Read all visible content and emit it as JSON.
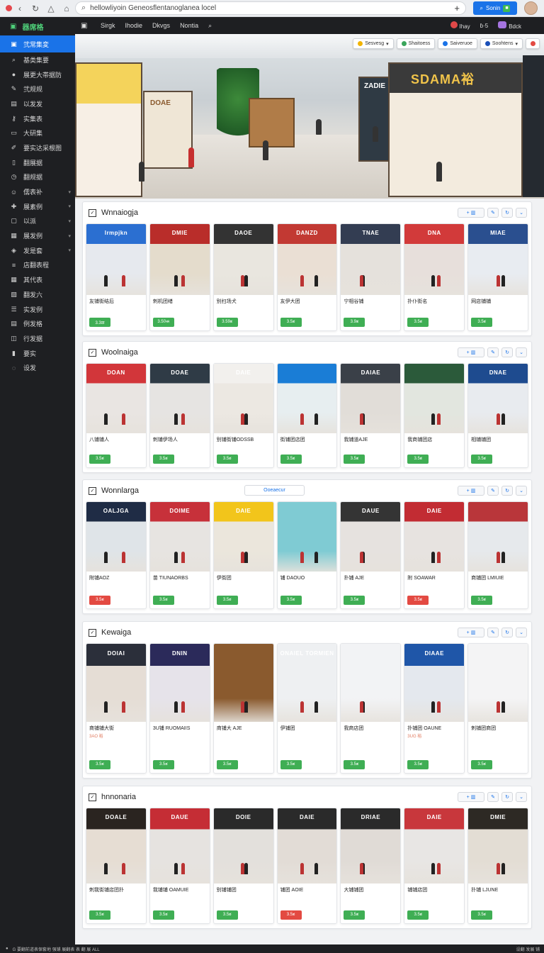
{
  "browser": {
    "address": "hellowliyoin Geneosflentanoglanea locel",
    "cta_label": "Sonin"
  },
  "sidebar": {
    "header": "器席格",
    "items": [
      {
        "label": "弐常集変",
        "icon": "window-icon",
        "active": true
      },
      {
        "label": "基类集要",
        "icon": "search-icon"
      },
      {
        "label": "展更大帯据防",
        "icon": "drop-icon"
      },
      {
        "label": "弐规规",
        "icon": "wrench-icon"
      },
      {
        "label": "以发发",
        "icon": "chart-icon"
      },
      {
        "label": "实集表",
        "icon": "key-icon"
      },
      {
        "label": "大研集",
        "icon": "folder-icon"
      },
      {
        "label": "要实达采根图",
        "icon": "pen-icon"
      },
      {
        "label": "翻展据",
        "icon": "doc-icon"
      },
      {
        "label": "翻规据",
        "icon": "clock-icon"
      },
      {
        "label": "儒表补",
        "icon": "users-icon",
        "chevron": true
      },
      {
        "label": "展素例",
        "icon": "puzzle-icon",
        "chevron": true
      },
      {
        "label": "以派",
        "icon": "box-icon",
        "chevron": true
      },
      {
        "label": "展发例",
        "icon": "cart-icon",
        "chevron": true
      },
      {
        "label": "发是套",
        "icon": "tag-icon",
        "chevron": true
      },
      {
        "label": "店翻表程",
        "icon": "stack-icon"
      },
      {
        "label": "其代表",
        "icon": "grid-icon"
      },
      {
        "label": "翻发六",
        "icon": "image-icon"
      },
      {
        "label": "实发例",
        "icon": "list-icon"
      },
      {
        "label": "例发格",
        "icon": "file-icon"
      },
      {
        "label": "行发据",
        "icon": "layers-icon"
      },
      {
        "label": "要实",
        "icon": "bookmark-icon"
      },
      {
        "label": "设发",
        "icon": "chat-icon"
      }
    ]
  },
  "topbar": {
    "links": [
      "Sirgk",
      "Ihodie",
      "Dkvgs",
      "Nontia"
    ],
    "right": [
      "Ihay",
      "ɓ·5",
      "Bdck"
    ]
  },
  "hero": {
    "sign_right": "SDAMA裕",
    "sign_mid": "ZADIE",
    "sign_left": "DOAE",
    "chips": [
      "Sesvesg",
      "Shaitoess",
      "Saiveruoe",
      "Soohtens"
    ]
  },
  "sections": [
    {
      "title": "Wnnaiogja",
      "cards": [
        {
          "title": "友铺街结后",
          "price": "3.3ळ",
          "color": "green",
          "bg": "#e6e9ee",
          "band": "#2b6fd1",
          "sign": "lrmpjkn"
        },
        {
          "title": "刺机团绪",
          "price": "3.50ಈ",
          "color": "green",
          "bg": "#e4dccc",
          "band": "#b92d2a",
          "sign": "DMIE"
        },
        {
          "title": "别扫场犬",
          "price": "3.59ಶ",
          "color": "green",
          "bg": "#e9e6df",
          "band": "#333",
          "sign": "DAOE"
        },
        {
          "title": "友伊大团",
          "price": "3.5ಶ",
          "color": "green",
          "bg": "#eadfd4",
          "band": "#c23933",
          "sign": "DANZD"
        },
        {
          "title": "宁相谷铺",
          "price": "3.9ಶ",
          "color": "green",
          "bg": "#e5e1dc",
          "band": "#333d52",
          "sign": "TNAE"
        },
        {
          "title": "扑仆街名",
          "price": "3.5ಶ",
          "color": "green",
          "bg": "#e7dfdb",
          "band": "#d23a3a",
          "sign": "DNA"
        },
        {
          "title": "网店铺铺",
          "price": "3.5ಶ",
          "color": "green",
          "bg": "#e8ecf1",
          "band": "#2a4f8f",
          "sign": "MIAE"
        }
      ]
    },
    {
      "title": "Woolnaiga",
      "cards": [
        {
          "title": "八铺铺人",
          "price": "3.5ಶ",
          "color": "green",
          "bg": "#e9e5e2",
          "band": "#d2363a",
          "sign": "DOAN"
        },
        {
          "title": "刺铺伊场人",
          "price": "3.5ಶ",
          "color": "green",
          "bg": "#e6e4e2",
          "band": "#2f3b46",
          "sign": "DOAE"
        },
        {
          "title": "别铺街铺ODSSB",
          "price": "3.5ಶ",
          "color": "green",
          "bg": "#ece8e2",
          "band": "#f2f0ed",
          "sign": "DAIE"
        },
        {
          "title": "街铺团店团",
          "price": "3.5ಶ",
          "color": "green",
          "bg": "#e7eef0",
          "band": "#1a7dd6",
          "sign": ""
        },
        {
          "title": "我铺道AJE",
          "price": "3.5ಶ",
          "color": "green",
          "bg": "#e1ddd8",
          "band": "#3a4048",
          "sign": "DAIAE"
        },
        {
          "title": "我商铺团店",
          "price": "3.5ಶ",
          "color": "green",
          "bg": "#e2e6df",
          "band": "#2b5a3a",
          "sign": ""
        },
        {
          "title": "相铺铺团",
          "price": "3.5ಶ",
          "color": "green",
          "bg": "#e8ebef",
          "band": "#1e4b8f",
          "sign": "DNAE"
        }
      ]
    },
    {
      "title": "Wonnlarga",
      "mid_button": "Ooeaecur",
      "cards": [
        {
          "title": "附铺AOZ",
          "price": "3.5ಶ",
          "color": "red",
          "bg": "#dfe4e8",
          "band": "#1f2c45",
          "sign": "OALJGA"
        },
        {
          "title": "苗 TIUNAORBS",
          "price": "3.5ಶ",
          "color": "green",
          "bg": "#e7e4e1",
          "band": "#c7313a",
          "sign": "DOIME"
        },
        {
          "title": "伊街团",
          "price": "3.5ಶ",
          "color": "green",
          "bg": "#ebe6dc",
          "band": "#f2c51b",
          "sign": "DAIE"
        },
        {
          "title": "铺 DAOUO",
          "price": "3.5ಶ",
          "color": "green",
          "bg": "#7fcbd3",
          "band": "#7fcbd3",
          "sign": ""
        },
        {
          "title": "扑铺 AJE",
          "price": "3.5ಶ",
          "color": "green",
          "bg": "#e6e2df",
          "band": "#343434",
          "sign": "DAUE"
        },
        {
          "title": "附 SOAWAR",
          "price": "3.5ಶ",
          "color": "red",
          "bg": "#e7e3e0",
          "band": "#c22c33",
          "sign": "DAIE"
        },
        {
          "title": "商铺团 LMIUIE",
          "price": "3.5ಶ",
          "color": "green",
          "bg": "#e6e9ec",
          "band": "#b9363a",
          "sign": ""
        }
      ]
    },
    {
      "title": "Kewaiga",
      "cards": [
        {
          "title": "商铺铺大街",
          "sub": "3AO 裕",
          "price": "3.5ಶ",
          "color": "green",
          "bg": "#e5ddd5",
          "band": "#2b2f3a",
          "sign": "DOIAI"
        },
        {
          "title": "3U铺 RUOMAIIS",
          "sub": "",
          "price": "3.5ಶ",
          "color": "green",
          "bg": "#e6e3ea",
          "band": "#2b2a5a",
          "sign": "DNIN"
        },
        {
          "title": "商铺大 AJE",
          "sub": "",
          "price": "3.5ಶ",
          "color": "green",
          "bg": "#8a5a2e",
          "band": "#8a5a2e",
          "sign": ""
        },
        {
          "title": "伊铺团",
          "sub": "",
          "price": "3.5ಶ",
          "color": "green",
          "bg": "#eef0f2",
          "band": "#eef0f2",
          "sign": "ONAIEL TORMIEN"
        },
        {
          "title": "我商店团",
          "sub": "",
          "price": "3.5ಶ",
          "color": "green",
          "bg": "#f2f3f5",
          "band": "#f2f3f5",
          "sign": ""
        },
        {
          "title": "扑铺团 OAUNE",
          "sub": "3UG 裕",
          "price": "3.5ಶ",
          "color": "green",
          "bg": "#e4e8ee",
          "band": "#1f56a8",
          "sign": "DIAAE"
        },
        {
          "title": "刺铺团商团",
          "sub": "",
          "price": "3.5ಶ",
          "color": "green",
          "bg": "#f4f4f5",
          "band": "#f4f4f5",
          "sign": ""
        }
      ]
    },
    {
      "title": "hnnonaria",
      "cards": [
        {
          "title": "刺我街铺店团扑",
          "price": "3.5ಶ",
          "color": "green",
          "bg": "#e6ddd3",
          "band": "#2a2420",
          "sign": "DOALE"
        },
        {
          "title": "我铺铺 OAMUIE",
          "price": "3.5ಶ",
          "color": "green",
          "bg": "#e6e3e0",
          "band": "#c52d35",
          "sign": "DAUE"
        },
        {
          "title": "别铺铺团",
          "price": "3.5ಶ",
          "color": "green",
          "bg": "#e3e0dc",
          "band": "#2a2a2a",
          "sign": "DOIE"
        },
        {
          "title": "铺团 AOIE",
          "price": "3.5ಶ",
          "color": "red",
          "bg": "#e2dcd6",
          "band": "#2a2a2a",
          "sign": "DAIE"
        },
        {
          "title": "大铺铺团",
          "price": "3.5ಶ",
          "color": "green",
          "bg": "#e0dbd6",
          "band": "#2a2a2a",
          "sign": "DRIAE"
        },
        {
          "title": "铺铺店团",
          "price": "3.5ಶ",
          "color": "green",
          "bg": "#e8e6e4",
          "band": "#c8373c",
          "sign": "DAIE"
        },
        {
          "title": "扑铺 LJUNE",
          "price": "3.5ಶ",
          "color": "green",
          "bg": "#e3ddd4",
          "band": "#2d2924",
          "sign": "DMIE"
        }
      ]
    }
  ],
  "statusbar": {
    "left": "G 要翻前道表保套地 强铺 展翻表 表 翻 展 ALL",
    "right": "设翻 发展 铺"
  }
}
